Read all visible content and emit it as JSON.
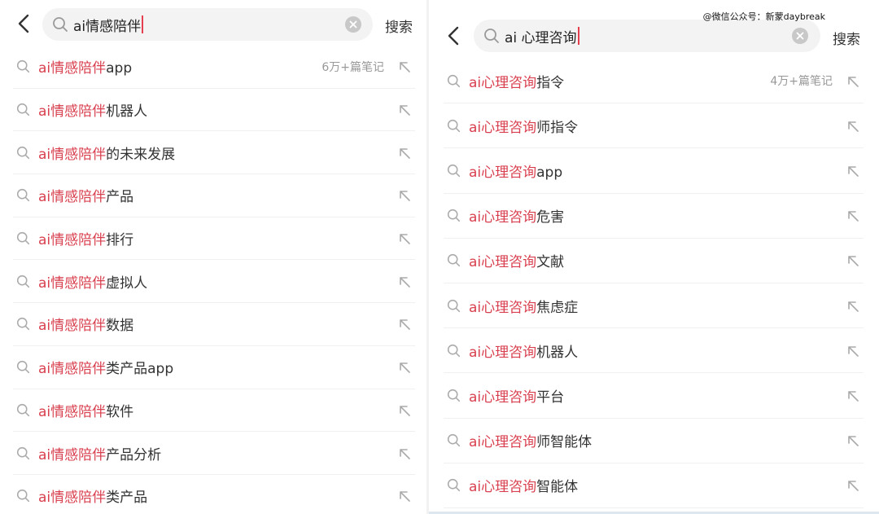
{
  "watermark": "@微信公众号：新蒙daybreak",
  "left": {
    "query": "ai情感陪伴",
    "search_label": "搜索",
    "items": [
      {
        "highlight": "ai情感陪伴",
        "rest": "app",
        "count": "6万+篇笔记"
      },
      {
        "highlight": "ai情感陪伴",
        "rest": "机器人",
        "count": ""
      },
      {
        "highlight": "ai情感陪伴",
        "rest": "的未来发展",
        "count": ""
      },
      {
        "highlight": "ai情感陪伴",
        "rest": "产品",
        "count": ""
      },
      {
        "highlight": "ai情感陪伴",
        "rest": "排行",
        "count": ""
      },
      {
        "highlight": "ai情感陪伴",
        "rest": "虚拟人",
        "count": ""
      },
      {
        "highlight": "ai情感陪伴",
        "rest": "数据",
        "count": ""
      },
      {
        "highlight": "ai情感陪伴",
        "rest": "类产品app",
        "count": ""
      },
      {
        "highlight": "ai情感陪伴",
        "rest": "软件",
        "count": ""
      },
      {
        "highlight": "ai情感陪伴",
        "rest": "产品分析",
        "count": ""
      },
      {
        "highlight": "ai情感陪伴",
        "rest": "类产品",
        "count": ""
      }
    ]
  },
  "right": {
    "query": "ai 心理咨询",
    "search_label": "搜索",
    "items": [
      {
        "highlight": "ai心理咨询",
        "rest": "指令",
        "count": "4万+篇笔记"
      },
      {
        "highlight": "ai心理咨询",
        "rest": "师指令",
        "count": ""
      },
      {
        "highlight": "ai心理咨询",
        "rest": "app",
        "count": ""
      },
      {
        "highlight": "ai心理咨询",
        "rest": "危害",
        "count": ""
      },
      {
        "highlight": "ai心理咨询",
        "rest": "文献",
        "count": ""
      },
      {
        "highlight": "ai心理咨询",
        "rest": "焦虑症",
        "count": ""
      },
      {
        "highlight": "ai心理咨询",
        "rest": "机器人",
        "count": ""
      },
      {
        "highlight": "ai心理咨询",
        "rest": "平台",
        "count": ""
      },
      {
        "highlight": "ai心理咨询",
        "rest": "师智能体",
        "count": ""
      },
      {
        "highlight": "ai心理咨询",
        "rest": "智能体",
        "count": ""
      }
    ]
  },
  "colors": {
    "highlight": "#d9404f",
    "text": "#333333",
    "muted": "#999999",
    "input_bg": "#f3f3f3"
  },
  "icons": {
    "back": "chevron-left-icon",
    "search": "search-icon",
    "clear": "clear-icon",
    "fill": "arrow-up-left-icon"
  }
}
